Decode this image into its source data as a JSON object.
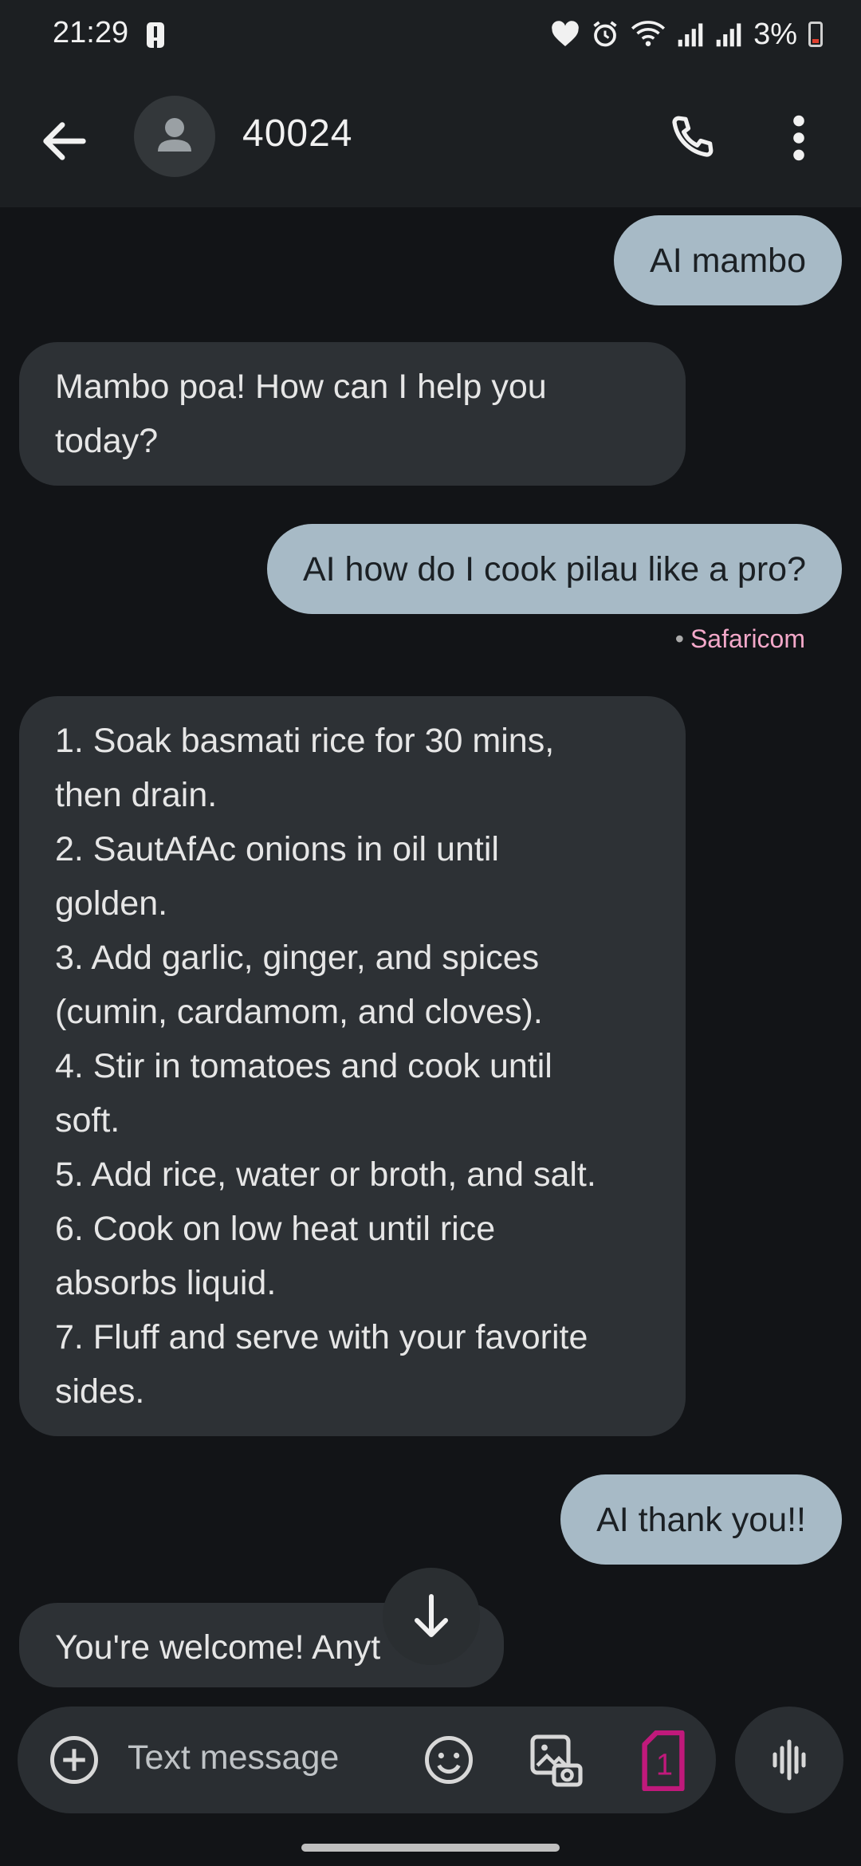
{
  "status_bar": {
    "time": "21:29",
    "battery": "3%"
  },
  "header": {
    "contact": "40024"
  },
  "messages": [
    {
      "dir": "out",
      "text": "AI mambo"
    },
    {
      "dir": "in",
      "text": "Mambo poa! How can I help you\ntoday?"
    },
    {
      "dir": "out",
      "text": "AI how do I cook pilau like a pro?"
    },
    {
      "dir": "in",
      "text": "1. Soak basmati rice for 30 mins,\nthen drain.\n2. SautAfAc onions in oil until\ngolden.\n3. Add garlic, ginger, and spices\n(cumin, cardamom, and cloves).\n4. Stir in tomatoes and cook until\nsoft.\n5. Add rice, water or broth, and salt.\n6. Cook on low heat until rice\nabsorbs liquid.\n7. Fluff and serve with your favorite\nsides."
    },
    {
      "dir": "out",
      "text": "AI thank you!!"
    },
    {
      "dir": "in",
      "text": "You're welcome! Anyt"
    }
  ],
  "sender_label": "Safaricom",
  "composer": {
    "placeholder": "Text message",
    "sim_slot": "1"
  },
  "icons": {
    "back": "arrow-left-icon",
    "avatar": "person-icon",
    "call": "phone-icon",
    "more": "more-vert-icon",
    "scroll": "arrow-down-icon",
    "add": "add-circle-icon",
    "emoji": "emoji-icon",
    "gallery": "gallery-icon",
    "sim": "sim-card-icon",
    "voice": "voice-wave-icon"
  },
  "colors": {
    "accent_pink": "#f3a8c9",
    "sim_magenta": "#c0197b",
    "outgoing_bubble": "#a7bac6",
    "incoming_bubble": "#2d3135"
  }
}
